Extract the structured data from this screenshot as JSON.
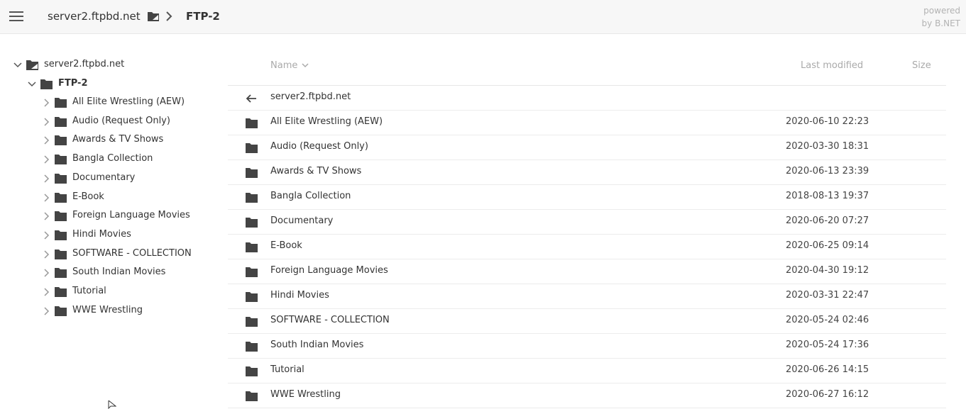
{
  "header": {
    "breadcrumb_root": "server2.ftpbd.net",
    "breadcrumb_current": "FTP-2",
    "powered_line1": "powered",
    "powered_line2": "by B.NET"
  },
  "tree": {
    "root": "server2.ftpbd.net",
    "current": "FTP-2",
    "children": [
      "All Elite Wrestling (AEW)",
      "Audio (Request Only)",
      "Awards & TV Shows",
      "Bangla Collection",
      "Documentary",
      "E-Book",
      "Foreign Language Movies",
      "Hindi Movies",
      "SOFTWARE - COLLECTION",
      "South Indian Movies",
      "Tutorial",
      "WWE Wrestling"
    ]
  },
  "list": {
    "columns": {
      "name": "Name",
      "modified": "Last modified",
      "size": "Size"
    },
    "parent_label": "server2.ftpbd.net",
    "rows": [
      {
        "name": "All Elite Wrestling (AEW)",
        "modified": "2020-06-10 22:23"
      },
      {
        "name": "Audio (Request Only)",
        "modified": "2020-03-30 18:31"
      },
      {
        "name": "Awards & TV Shows",
        "modified": "2020-06-13 23:39"
      },
      {
        "name": "Bangla Collection",
        "modified": "2018-08-13 19:37"
      },
      {
        "name": "Documentary",
        "modified": "2020-06-20 07:27"
      },
      {
        "name": "E-Book",
        "modified": "2020-06-25 09:14"
      },
      {
        "name": "Foreign Language Movies",
        "modified": "2020-04-30 19:12"
      },
      {
        "name": "Hindi Movies",
        "modified": "2020-03-31 22:47"
      },
      {
        "name": "SOFTWARE - COLLECTION",
        "modified": "2020-05-24 02:46"
      },
      {
        "name": "South Indian Movies",
        "modified": "2020-05-24 17:36"
      },
      {
        "name": "Tutorial",
        "modified": "2020-06-26 14:15"
      },
      {
        "name": "WWE Wrestling",
        "modified": "2020-06-27 16:12"
      }
    ]
  },
  "icons": {
    "menu": "hamburger-icon",
    "folder": "folder-icon",
    "chevron_right": "chevron-right-icon",
    "chevron_down": "chevron-down-icon",
    "back": "arrow-left-icon"
  },
  "colors": {
    "icon": "#444444",
    "header_bg": "#f7f7f7",
    "muted": "#aaaaaa"
  }
}
